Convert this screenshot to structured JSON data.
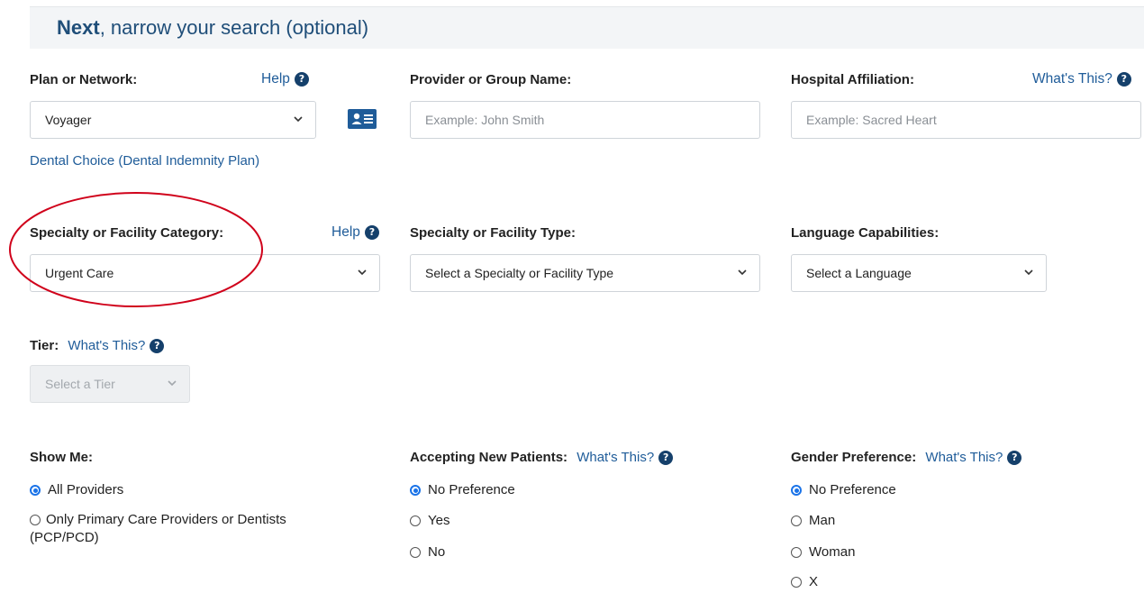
{
  "header": {
    "title_bold": "Next",
    "title_rest": ", narrow your search (optional)"
  },
  "plan": {
    "label": "Plan or Network:",
    "help": "Help",
    "selected": "Voyager",
    "sub_link": "Dental Choice (Dental Indemnity Plan)"
  },
  "provider": {
    "label": "Provider or Group Name:",
    "placeholder": "Example: John Smith"
  },
  "hospital": {
    "label": "Hospital Affiliation:",
    "whats_this": "What's This?",
    "placeholder": "Example: Sacred Heart"
  },
  "specialty_category": {
    "label": "Specialty or Facility Category:",
    "help": "Help",
    "selected": "Urgent Care"
  },
  "specialty_type": {
    "label": "Specialty or Facility Type:",
    "selected": "Select a Specialty or Facility Type"
  },
  "language": {
    "label": "Language Capabilities:",
    "selected": "Select a Language"
  },
  "tier": {
    "label": "Tier:",
    "whats_this": "What's This?",
    "selected": "Select a Tier"
  },
  "show_me": {
    "label": "Show Me:",
    "options": [
      "All Providers",
      "Only Primary Care Providers or Dentists (PCP/PCD)"
    ],
    "selected_index": 0
  },
  "accepting": {
    "label": "Accepting New Patients:",
    "whats_this": "What's This?",
    "options": [
      "No Preference",
      "Yes",
      "No"
    ],
    "selected_index": 0
  },
  "gender": {
    "label": "Gender Preference:",
    "whats_this": "What's This?",
    "options": [
      "No Preference",
      "Man",
      "Woman",
      "X"
    ],
    "selected_index": 0
  },
  "colors": {
    "link": "#1f5c99",
    "heading": "#1f4e79",
    "annotation": "#d0021b",
    "radio": "#1a73e8"
  }
}
